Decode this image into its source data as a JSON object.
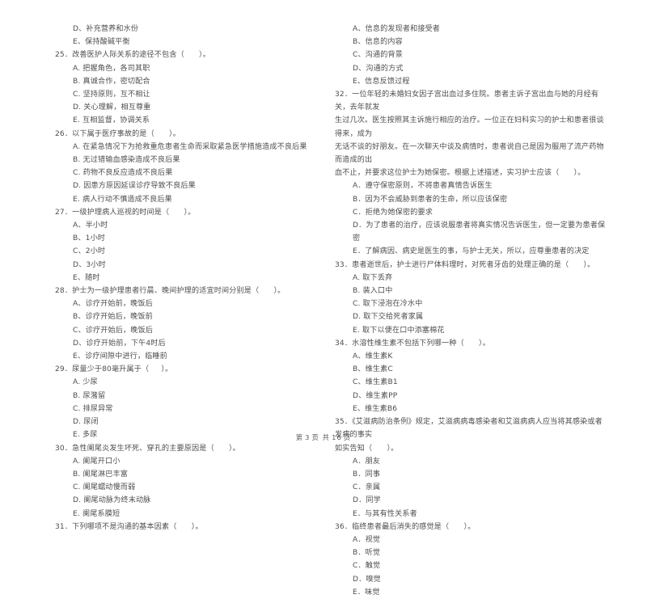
{
  "document": {
    "type": "exam-paper",
    "page_footer": {
      "prefix": "第",
      "current_page": "3",
      "middle": "页  共",
      "total_pages": "16",
      "suffix": "页"
    }
  },
  "left_column": {
    "continued_options": [
      "D、补充营养和水份",
      "E、保持酸碱平衡"
    ],
    "questions": [
      {
        "number": "25",
        "stem": "25．改善医护人际关系的途径不包含（      ）。",
        "options": [
          "A. 把握角色，各司其职",
          "B. 真诚合作，密切配合",
          "C. 坚持原则，互不相让",
          "D. 关心理解，相互尊重",
          "E. 互相监督，协调关系"
        ]
      },
      {
        "number": "26",
        "stem": "26．以下属于医疗事故的是（      ）。",
        "options": [
          "A. 在紧急情况下为抢救重危患者生命而采取紧急医学措施造成不良后果",
          "B. 无过错输血感染造成不良后果",
          "C. 药物不良反应造成不良后果",
          "D. 因患方原因延误诊疗导致不良后果",
          "E. 病人行动不慎造成不良后果"
        ]
      },
      {
        "number": "27",
        "stem": "27．一级护理病人巡视的时间是（      ）。",
        "options": [
          "A、半小时",
          "B、1小时",
          "C、2小时",
          "D、3小时",
          "E、随时"
        ]
      },
      {
        "number": "28",
        "stem": "28．护士为一级护理患者行晨、晚间护理的适宜时间分别是（      ）。",
        "options": [
          "A、诊疗开始前，晚饭后",
          "B、诊疗开始后，晚饭前",
          "C、诊疗开始后，晚饭后",
          "D、诊疗开始前，下午4时后",
          "E、诊疗间隙中进行，临睡前"
        ]
      },
      {
        "number": "29",
        "stem": "29．尿量少于80毫升属于（     ）。",
        "options": [
          "A. 少尿",
          "B. 尿潴留",
          "C. 排尿异常",
          "D. 尿闭",
          "E. 多尿"
        ]
      },
      {
        "number": "30",
        "stem": "30．急性阑尾炎发生坏死、穿孔的主要原因是（      ）。",
        "options": [
          "A. 阑尾开口小",
          "B. 阑尾淋巴丰富",
          "C. 阑尾蠕动慢而弱",
          "D. 阑尾动脉为终末动脉",
          "E. 阑尾系膜短"
        ]
      },
      {
        "number": "31",
        "stem": "31．下列哪项不是沟通的基本因素（      ）。",
        "options": []
      }
    ]
  },
  "right_column": {
    "continued_options": [
      "A、信息的发现者和接受者",
      "B、信息的内容",
      "C、沟通的背景",
      "D、沟通的方式",
      "E、信息反馈过程"
    ],
    "questions": [
      {
        "number": "32",
        "stem_lines": [
          "32．一位年轻的未婚妇女因子宫出血过多住院。患者主诉子宫出血与她的月经有关，去年就发",
          "生过几次。医生按照其主诉施行相应的治疗。一位正在妇科实习的护士和患者很谈得来，成为",
          "无话不谈的好朋友。在一次聊天中谈及病情时，患者说自己是因为服用了流产药物而造成的出",
          "血不止，并要求这位护士为她保密。根据上述描述，实习护士应该（      ）。"
        ],
        "options": [
          "A．遵守保密原则，不将患者真情告诉医生",
          "B．因为不会威胁到患者的生命，所以应该保密",
          "C．拒绝为她保密的要求",
          "D．为了患者的治疗，应该说服患者将真实情况告诉医生，但一定要为患者保密",
          "E．了解病因、病史是医生的事，与护士无关，所以，应尊重患者的决定"
        ]
      },
      {
        "number": "33",
        "stem": "33．患者逝世后，护士进行尸体料理时，对死者牙齿的处理正确的是（      ）。",
        "options": [
          "A. 取下丢弃",
          "B. 装入口中",
          "C. 取下浸泡在冷水中",
          "D. 取下交给死者家属",
          "E. 取下以便在口中添塞棉花"
        ]
      },
      {
        "number": "34",
        "stem": "34．水溶性维生素不包括下列哪一种（      ）。",
        "options": [
          "A、维生素K",
          "B、维生素C",
          "C、维生素B1",
          "D、维生素PP",
          "E、维生素B6"
        ]
      },
      {
        "number": "35",
        "stem_lines": [
          "35．《艾滋病防治条例》规定，艾滋病病毒感染者和艾滋病病人应当将其感染或者发病的事实",
          "如实告知（      ）。"
        ],
        "options": [
          "A．朋友",
          "B．同事",
          "C．亲属",
          "D．同学",
          "E．与其有性关系者"
        ]
      },
      {
        "number": "36",
        "stem": "36．临终患者最后消失的感觉是（      ）。",
        "options": [
          "A．视觉",
          "B．听觉",
          "C．触觉",
          "D．嗅觉",
          "E．味觉"
        ]
      }
    ]
  }
}
